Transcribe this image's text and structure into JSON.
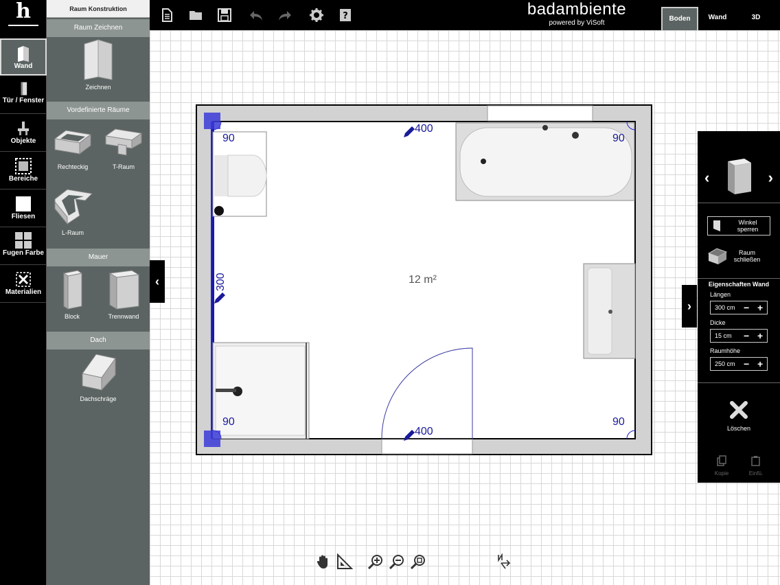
{
  "rail": {
    "items": [
      {
        "label": "Wand",
        "icon": "wall-icon"
      },
      {
        "label": "Tür / Fenster",
        "icon": "door-icon"
      },
      {
        "label": "Objekte",
        "icon": "faucet-icon"
      },
      {
        "label": "Bereiche",
        "icon": "area-icon"
      },
      {
        "label": "Fliesen",
        "icon": "tile-icon"
      },
      {
        "label": "Fugen Farbe",
        "icon": "grout-icon"
      },
      {
        "label": "Materialien",
        "icon": "materials-icon"
      }
    ]
  },
  "panel": {
    "title": "Raum Konstruktion",
    "sections": {
      "draw": "Raum Zeichnen",
      "predefined": "Vordefinierte Räume",
      "wall": "Mauer",
      "roof": "Dach"
    },
    "tools": {
      "zeichnen": "Zeichnen",
      "rechteckig": "Rechteckig",
      "t_raum": "T-Raum",
      "l_raum": "L-Raum",
      "block": "Block",
      "trennwand": "Trennwand",
      "dachschraege": "Dachschräge"
    }
  },
  "topbar": {
    "icons": [
      "new-document-icon",
      "open-folder-icon",
      "save-icon",
      "undo-icon",
      "redo-icon",
      "settings-icon",
      "help-icon"
    ],
    "brand_name": "badambiente",
    "brand_sub": "powered by ViSoft",
    "views": [
      "Boden",
      "Wand",
      "3D"
    ],
    "active_view": "Boden"
  },
  "plan": {
    "area_label": "12 m²",
    "dims": {
      "top": "400",
      "bottom": "400",
      "left": "300"
    },
    "angles": [
      "90",
      "90",
      "90",
      "90"
    ]
  },
  "rpanel": {
    "lock_angle": "Winkel sperren",
    "close_room": "Raum schließen",
    "props_title": "Eigenschaften Wand",
    "length_label": "Längen",
    "length_value": "300 cm",
    "thickness_label": "Dicke",
    "thickness_value": "15 cm",
    "height_label": "Raumhöhe",
    "height_value": "250 cm",
    "minus": "−",
    "plus": "+",
    "delete": "Löschen",
    "copy": "Kopie",
    "paste": "Einfü."
  },
  "bottombar": {
    "icons": [
      "pan-hand-icon",
      "measure-icon",
      "zoom-in-icon",
      "zoom-out-icon",
      "zoom-fit-icon",
      "north-arrow-icon"
    ]
  }
}
